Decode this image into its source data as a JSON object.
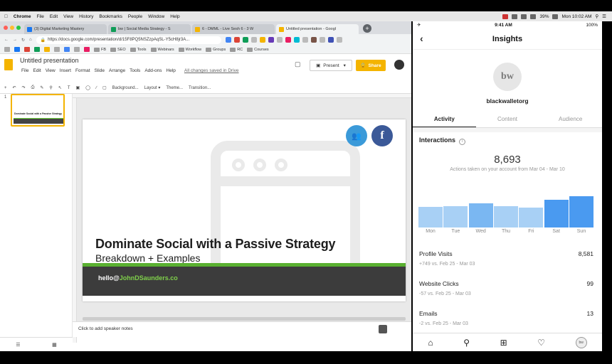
{
  "macbar": {
    "app": "Chrome",
    "menus": [
      "File",
      "Edit",
      "View",
      "History",
      "Bookmarks",
      "People",
      "Window",
      "Help"
    ],
    "battery": "39%",
    "clock": "Mon 10:02 AM"
  },
  "browser": {
    "tabs": [
      {
        "label": "(3) Digital Marketing Mastery",
        "color": "#1877f2"
      },
      {
        "label": "bw | Social Media Strategy - S",
        "color": "#0f9d58"
      },
      {
        "label": "6 - DMML - Live Sesh 6 - 3 W",
        "color": "#f4b400"
      },
      {
        "label": "Untitled presentation - Googl",
        "color": "#f4b400"
      }
    ],
    "url": "https://docs.google.com/presentation/d/15F8PQ5NSZzpAqSL-Y5cH8jr3A...",
    "bookmarks": [
      "FB",
      "SEO",
      "Tools",
      "Webinars",
      "Workflow",
      "Groups",
      "RC",
      "Courses"
    ]
  },
  "slides": {
    "doc_title": "Untitled presentation",
    "menus": [
      "File",
      "Edit",
      "View",
      "Insert",
      "Format",
      "Slide",
      "Arrange",
      "Tools",
      "Add-ons",
      "Help"
    ],
    "saved": "All changes saved in Drive",
    "present": "Present",
    "share": "Share",
    "toolbar": [
      "Background...",
      "Layout ▾",
      "Theme...",
      "Transition..."
    ],
    "slide_number": "1",
    "slide_title": "Dominate Social with a Passive Strategy",
    "slide_subtitle": "Breakdown + Examples",
    "email_prefix": "hello@",
    "email_domain": "JohnDSaunders.co",
    "speaker_notes": "Click to add speaker notes"
  },
  "phone": {
    "time": "9:41 AM",
    "battery": "100%",
    "title": "Insights",
    "avatar_text": "bw",
    "username": "blackwalletorg",
    "tabs": [
      "Activity",
      "Content",
      "Audience"
    ],
    "section": "Interactions",
    "total": "8,693",
    "total_caption": "Actions taken on your account from Mar 04 - Mar 10",
    "days": [
      "Mon",
      "Tue",
      "Wed",
      "Thu",
      "Fri",
      "Sat",
      "Sun"
    ],
    "bar_values": [
      0.58,
      0.6,
      0.68,
      0.6,
      0.56,
      0.78,
      0.88
    ],
    "rows": [
      {
        "label": "Profile Visits",
        "value": "8,581",
        "delta": "+749 vs. Feb 25 - Mar 03"
      },
      {
        "label": "Website Clicks",
        "value": "99",
        "delta": "-57 vs. Feb 25 - Mar 03"
      },
      {
        "label": "Emails",
        "value": "13",
        "delta": "-2 vs. Feb 25 - Mar 03"
      }
    ]
  }
}
